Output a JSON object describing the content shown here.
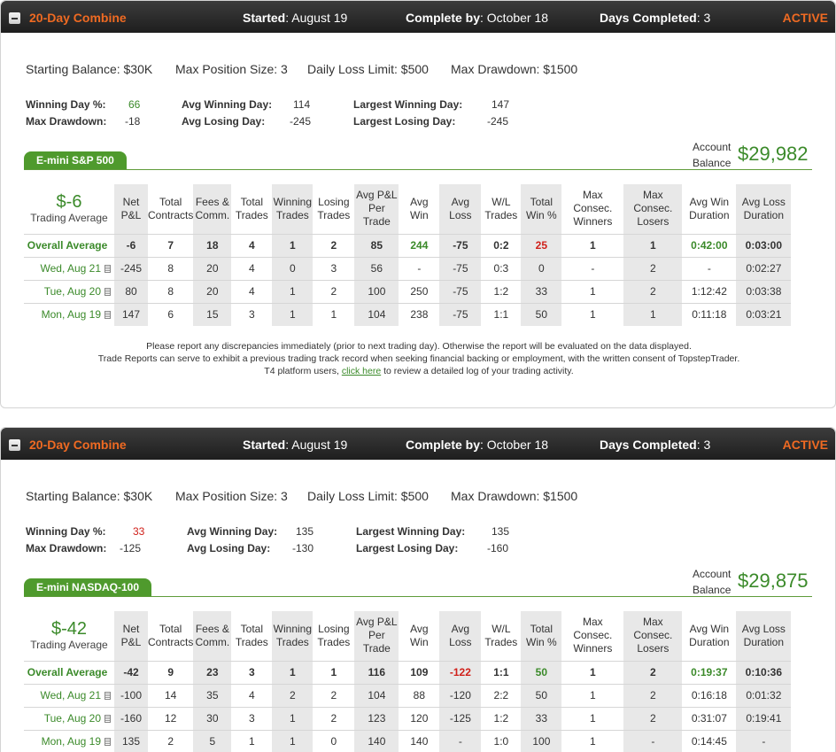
{
  "colors": {
    "accent_orange": "#ef6a22",
    "green": "#3b8a2a",
    "red": "#d0201a",
    "tab_green": "#4f9a2d"
  },
  "icons": {
    "collapse": "collapse-icon",
    "report": "report-document-icon"
  },
  "combines": [
    {
      "title": "20-Day Combine",
      "started_label": "Started",
      "started": ": August 19",
      "complete_label": "Complete by",
      "complete": ": October 18",
      "days_label": "Days Completed",
      "days": ": 3",
      "status": "ACTIVE",
      "starting_balance": "Starting Balance: $30K",
      "max_position": "Max Position Size: 3",
      "daily_loss": "Daily Loss Limit: $500",
      "max_drawdown_limit": "Max Drawdown: $1500",
      "stats": {
        "winning_day_pct_label": "Winning Day %:",
        "winning_day_pct": "66",
        "max_drawdown_label": "Max Drawdown:",
        "max_drawdown": "-18",
        "avg_winning_day_label": "Avg Winning Day:",
        "avg_winning_day": "114",
        "avg_losing_day_label": "Avg Losing Day:",
        "avg_losing_day": "-245",
        "largest_winning_day_label": "Largest Winning Day:",
        "largest_winning_day": "147",
        "largest_losing_day_label": "Largest Losing Day:",
        "largest_losing_day": "-245"
      },
      "product_tab": "E-mini S&P 500",
      "account_balance_label_1": "Account",
      "account_balance_label_2": "Balance",
      "account_balance": "$29,982",
      "trading_average_value": "$-6",
      "trading_average_label": "Trading Average",
      "overall": [
        "Overall Average",
        "-6",
        "7",
        "18",
        "4",
        "1",
        "2",
        "85",
        "244",
        "-75",
        "0:2",
        "25",
        "1",
        "1",
        "0:42:00",
        "0:03:00"
      ],
      "rows": [
        [
          "Wed, Aug 21",
          "-245",
          "8",
          "20",
          "4",
          "0",
          "3",
          "56",
          "-",
          "-75",
          "0:3",
          "0",
          "-",
          "2",
          "-",
          "0:02:27"
        ],
        [
          "Tue, Aug 20",
          "80",
          "8",
          "20",
          "4",
          "1",
          "2",
          "100",
          "250",
          "-75",
          "1:2",
          "33",
          "1",
          "2",
          "1:12:42",
          "0:03:38"
        ],
        [
          "Mon, Aug 19",
          "147",
          "6",
          "15",
          "3",
          "1",
          "1",
          "104",
          "238",
          "-75",
          "1:1",
          "50",
          "1",
          "1",
          "0:11:18",
          "0:03:21"
        ]
      ],
      "footer_line_1": "Please report any discrepancies immediately (prior to next trading day). Otherwise the report will be evaluated on the data displayed.",
      "footer_line_2": "Trade Reports can serve to exhibit a previous trading track record when seeking financial backing or employment, with the written consent of TopstepTrader.",
      "footer_line_3_pre": "T4 platform users, ",
      "footer_link": "click here",
      "footer_line_3_post": " to review a detailed log of your trading activity."
    },
    {
      "title": "20-Day Combine",
      "started_label": "Started",
      "started": ": August 19",
      "complete_label": "Complete by",
      "complete": ": October 18",
      "days_label": "Days Completed",
      "days": ": 3",
      "status": "ACTIVE",
      "starting_balance": "Starting Balance: $30K",
      "max_position": "Max Position Size: 3",
      "daily_loss": "Daily Loss Limit: $500",
      "max_drawdown_limit": "Max Drawdown: $1500",
      "stats": {
        "winning_day_pct_label": "Winning Day %:",
        "winning_day_pct": "33",
        "max_drawdown_label": "Max Drawdown:",
        "max_drawdown": "-125",
        "avg_winning_day_label": "Avg Winning Day:",
        "avg_winning_day": "135",
        "avg_losing_day_label": "Avg Losing Day:",
        "avg_losing_day": "-130",
        "largest_winning_day_label": "Largest Winning Day:",
        "largest_winning_day": "135",
        "largest_losing_day_label": "Largest Losing Day:",
        "largest_losing_day": "-160"
      },
      "product_tab": "E-mini NASDAQ-100",
      "account_balance_label_1": "Account",
      "account_balance_label_2": "Balance",
      "account_balance": "$29,875",
      "trading_average_value": "$-42",
      "trading_average_label": "Trading Average",
      "overall": [
        "Overall Average",
        "-42",
        "9",
        "23",
        "3",
        "1",
        "1",
        "116",
        "109",
        "-122",
        "1:1",
        "50",
        "1",
        "2",
        "0:19:37",
        "0:10:36"
      ],
      "rows": [
        [
          "Wed, Aug 21",
          "-100",
          "14",
          "35",
          "4",
          "2",
          "2",
          "104",
          "88",
          "-120",
          "2:2",
          "50",
          "1",
          "2",
          "0:16:18",
          "0:01:32"
        ],
        [
          "Tue, Aug 20",
          "-160",
          "12",
          "30",
          "3",
          "1",
          "2",
          "123",
          "120",
          "-125",
          "1:2",
          "33",
          "1",
          "2",
          "0:31:07",
          "0:19:41"
        ],
        [
          "Mon, Aug 19",
          "135",
          "2",
          "5",
          "1",
          "1",
          "0",
          "140",
          "140",
          "-",
          "1:0",
          "100",
          "1",
          "-",
          "0:14:45",
          "-"
        ]
      ]
    }
  ],
  "columns": [
    [
      "Net",
      "P&L"
    ],
    [
      "Total",
      "Contracts"
    ],
    [
      "Fees &",
      "Comm."
    ],
    [
      "Total",
      "Trades"
    ],
    [
      "Winning",
      "Trades"
    ],
    [
      "Losing",
      "Trades"
    ],
    [
      "Avg P&L",
      "Per",
      "Trade"
    ],
    [
      "Avg",
      "Win"
    ],
    [
      "Avg",
      "Loss"
    ],
    [
      "W/L",
      "Trades"
    ],
    [
      "Total",
      "Win %"
    ],
    [
      "Max Consec.",
      "Winners"
    ],
    [
      "Max Consec.",
      "Losers"
    ],
    [
      "Avg Win",
      "Duration"
    ],
    [
      "Avg Loss",
      "Duration"
    ]
  ]
}
